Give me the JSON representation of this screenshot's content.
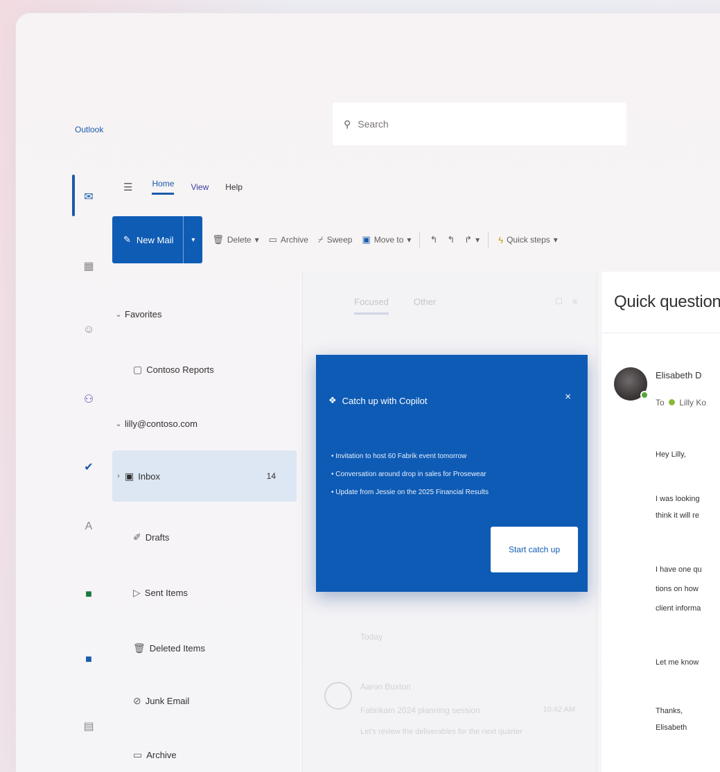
{
  "app": {
    "title": "Outlook"
  },
  "search": {
    "placeholder": "Search"
  },
  "ribbon": {
    "tabs": [
      "Home",
      "View",
      "Help"
    ],
    "new_mail_label": "New Mail",
    "commands": [
      "Delete",
      "Archive",
      "Sweep",
      "Move to",
      "Quick steps"
    ]
  },
  "folders": {
    "favorites_label": "Favorites",
    "favorite_items": [
      "Contoso Reports"
    ],
    "account_label": "lilly@contoso.com",
    "inbox_label": "Inbox",
    "inbox_count": "14",
    "items": [
      "Drafts",
      "Sent Items",
      "Deleted Items",
      "Junk Email",
      "Archive"
    ]
  },
  "message_list": {
    "tabs": [
      "Focused",
      "Other"
    ],
    "group_label": "Today",
    "item": {
      "sender": "Aaron Buxton",
      "subject": "Fabrikam 2024 planning session",
      "preview": "Let's review the deliverables for the next quarter",
      "date": "10:42 AM"
    }
  },
  "copilot": {
    "title": "Catch up with Copilot",
    "bullets": [
      "Invitation to host 60 Fabrik event tomorrow",
      "Conversation around drop in sales for Prosewear",
      "Update from Jessie on the 2025 Financial Results"
    ],
    "button_label": "Start catch up"
  },
  "reading_pane": {
    "subject": "Quick question",
    "sender": "Elisabeth D",
    "to_prefix": "To",
    "to_name": "Lilly Ko",
    "body": [
      "Hey Lilly,",
      "I was looking",
      "think it will re",
      "I have one qu",
      "tions on how",
      "client informa",
      "Let me know",
      "Thanks,",
      "Elisabeth"
    ]
  }
}
